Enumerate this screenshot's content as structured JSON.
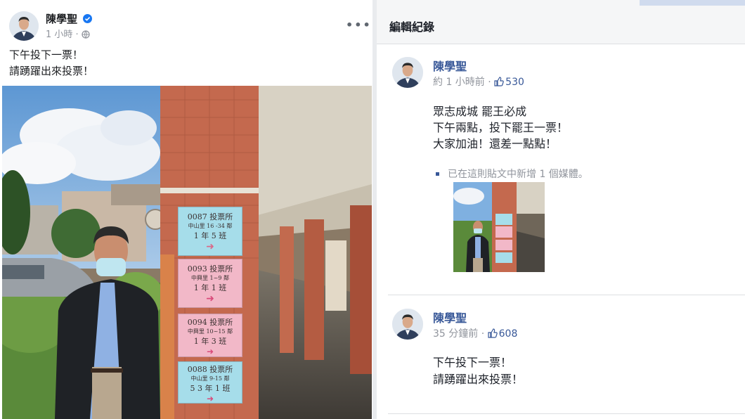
{
  "left_post": {
    "author": "陳學聖",
    "timestamp": "1 小時",
    "globe_icon": "globe-icon",
    "verified_icon": "verified-badge-icon",
    "more_label": "•••",
    "text_lines": [
      "下午投下一票！",
      "請踴躍出來投票！"
    ],
    "photo_signs": [
      {
        "line1": "0087 投票所",
        "line2": "中山里 16 -34 鄰",
        "line3": "1 年 5 班",
        "color": "#a6ddea"
      },
      {
        "line1": "0093 投票所",
        "line2": "中興里 1~9 鄰",
        "line3": "1 年 1 班",
        "color": "#f2b8c8"
      },
      {
        "line1": "0094 投票所",
        "line2": "中興里 10~15 鄰",
        "line3": "1 年 3 班",
        "color": "#f2b8c8"
      },
      {
        "line1": "0088 投票所",
        "line2": "中山里 9-15 鄰",
        "line3": "5 3 年 1 班",
        "color": "#a6ddea"
      }
    ]
  },
  "edit_history": {
    "title": "編輯紀錄",
    "entries": [
      {
        "author": "陳學聖",
        "timestamp": "約 1 小時前 ·",
        "likes": "530",
        "text_lines": [
          "眾志成城 罷王必成",
          "下午兩點，投下罷王一票！",
          "大家加油！還差一點點！"
        ],
        "media_note": "已在這則貼文中新增 1 個媒體。"
      },
      {
        "author": "陳學聖",
        "timestamp": "35 分鐘前 ·",
        "likes": "608",
        "text_lines": [
          "下午投下一票！",
          "請踴躍出來投票！"
        ]
      }
    ]
  },
  "colors": {
    "brand_blue": "#385898",
    "verified_blue": "#1877f2",
    "divider": "#dddfe2"
  }
}
